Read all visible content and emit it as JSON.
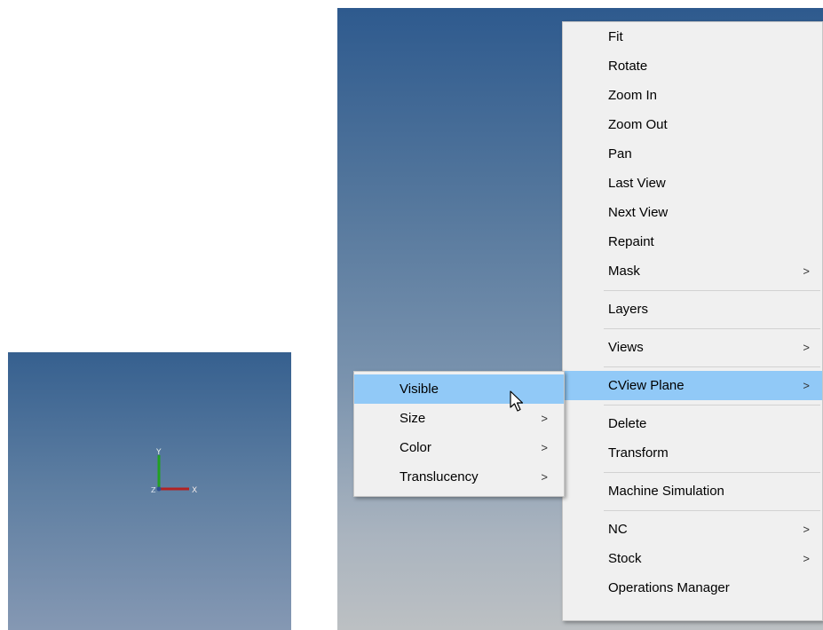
{
  "context_menu": {
    "items": [
      {
        "label": "Fit",
        "submenu": false
      },
      {
        "label": "Rotate",
        "submenu": false
      },
      {
        "label": "Zoom In",
        "submenu": false
      },
      {
        "label": "Zoom Out",
        "submenu": false
      },
      {
        "label": "Pan",
        "submenu": false
      },
      {
        "label": "Last View",
        "submenu": false
      },
      {
        "label": "Next View",
        "submenu": false
      },
      {
        "label": "Repaint",
        "submenu": false
      },
      {
        "label": "Mask",
        "submenu": true
      },
      {
        "label": "Layers",
        "submenu": false
      },
      {
        "label": "Views",
        "submenu": true
      },
      {
        "label": "CView Plane",
        "submenu": true,
        "highlighted": true
      },
      {
        "label": "Delete",
        "submenu": false
      },
      {
        "label": "Transform",
        "submenu": false
      },
      {
        "label": "Machine Simulation",
        "submenu": false
      },
      {
        "label": "NC",
        "submenu": true
      },
      {
        "label": "Stock",
        "submenu": true
      },
      {
        "label": "Operations Manager",
        "submenu": false
      }
    ],
    "arrow_glyph": ">"
  },
  "cview_submenu": {
    "items": [
      {
        "label": "Visible",
        "submenu": false,
        "highlighted": true
      },
      {
        "label": "Size",
        "submenu": true
      },
      {
        "label": "Color",
        "submenu": true
      },
      {
        "label": "Translucency",
        "submenu": true
      }
    ]
  },
  "axis_triad": {
    "labels": {
      "x": "X",
      "y": "Y",
      "z": "Z"
    },
    "colors": {
      "x": "#b22222",
      "y": "#22a022",
      "z": "#2f4f8f"
    }
  },
  "colors": {
    "menu_background": "#f0f0f0",
    "highlight": "#91c9f7",
    "viewport_top": "#2e5a8e",
    "viewport_bottom": "#bcc0c3"
  }
}
